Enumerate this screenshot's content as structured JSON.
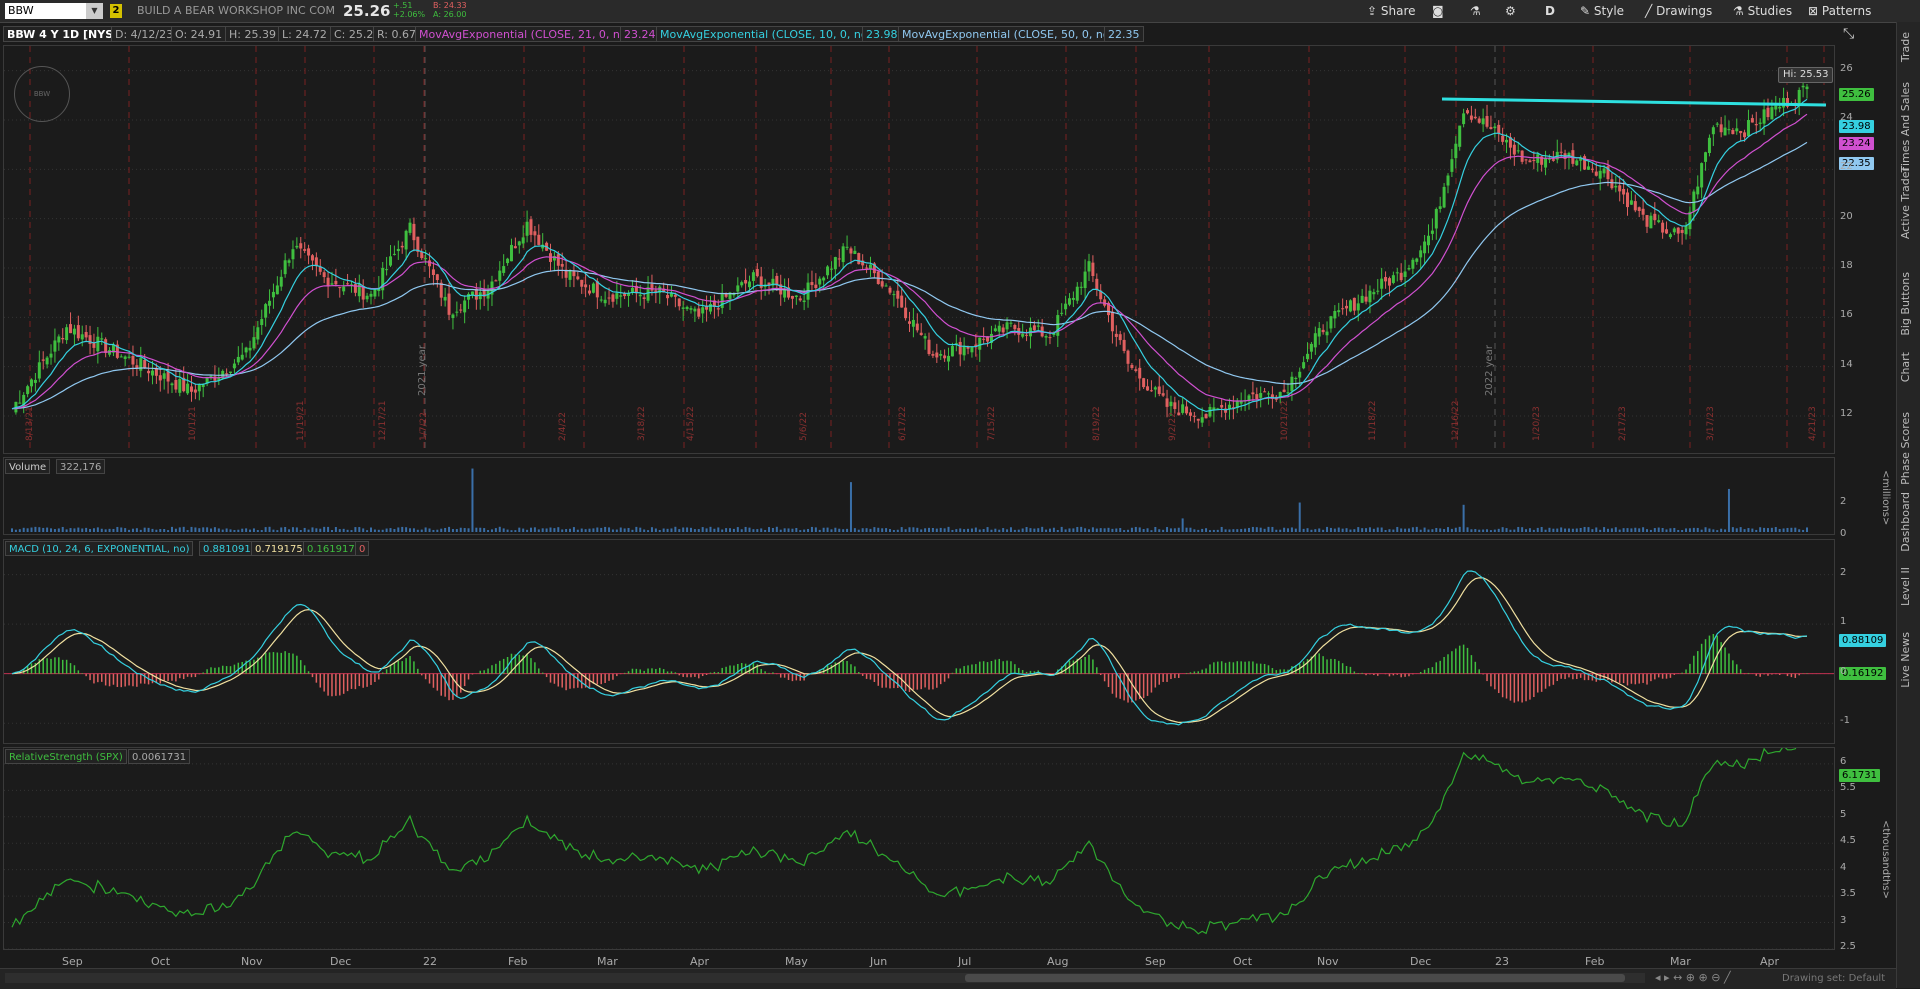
{
  "toolbar": {
    "symbol": "BBW",
    "link_number": "2",
    "company": "BUILD A BEAR WORKSHOP INC COM",
    "last_price": "25.26",
    "net_change": "+.51",
    "pct_change": "+2.06%",
    "bid": "B: 24.33",
    "ask": "A: 26.00",
    "share_label": "Share",
    "aggregation": "D",
    "style_label": "Style",
    "drawings_label": "Drawings",
    "studies_label": "Studies",
    "patterns_label": "Patterns"
  },
  "infobar": {
    "title": "BBW 4 Y 1D [NYSE]",
    "date": "D: 4/12/23",
    "open": "O: 24.91",
    "high": "H: 25.39",
    "low": "L: 24.72",
    "close": "C: 25.26",
    "range": "R: 0.67",
    "ema21_label": "MovAvgExponential (CLOSE, 21, 0, no)",
    "ema21_value": "23.24",
    "ema10_label": "MovAvgExponential (CLOSE, 10, 0, no)",
    "ema10_value": "23.98",
    "ema50_label": "MovAvgExponential (CLOSE, 50, 0, no)",
    "ema50_value": "22.35"
  },
  "price_panel": {
    "hi_label": "Hi: 25.53",
    "last_tag": "25.26",
    "ema10_tag": "23.98",
    "ema21_tag": "23.24",
    "ema50_tag": "22.35",
    "y_ticks": [
      "26",
      "24",
      "22",
      "20",
      "18",
      "16",
      "14",
      "12"
    ],
    "year_markers": [
      "2021 year",
      "2022 year"
    ],
    "date_markers": [
      "8/13/21",
      "10/1/21",
      "11/19/21",
      "12/17/21",
      "1/7/22",
      "2/4/22",
      "3/18/22",
      "4/15/22",
      "5/6/22",
      "6/17/22",
      "7/15/22",
      "8/19/22",
      "9/2/22",
      "10/21/22",
      "11/18/22",
      "12/16/22",
      "1/20/23",
      "2/17/23",
      "3/17/23",
      "4/21/23"
    ]
  },
  "volume_panel": {
    "label": "Volume",
    "value": "322,176",
    "y_ticks": [
      "2",
      "0"
    ],
    "unit": "<millions>"
  },
  "macd_panel": {
    "label": "MACD (10, 24, 6, EXPONENTIAL, no)",
    "value": "0.881091",
    "avg": "0.719175",
    "diff": "0.161917",
    "zero": "0",
    "tag_value": "0.88109",
    "tag_diff": "0.16192",
    "y_ticks": [
      "2",
      "1",
      "0",
      "-1"
    ]
  },
  "rs_panel": {
    "label": "RelativeStrength (SPX)",
    "value": "0.0061731",
    "tag": "6.1731",
    "y_ticks": [
      "6",
      "5.5",
      "5",
      "4.5",
      "4",
      "3.5",
      "3",
      "2.5"
    ],
    "unit": "<thousandths>"
  },
  "x_axis": [
    "Sep",
    "Oct",
    "Nov",
    "Dec",
    "22",
    "Feb",
    "Mar",
    "Apr",
    "May",
    "Jun",
    "Jul",
    "Aug",
    "Sep",
    "Oct",
    "Nov",
    "Dec",
    "23",
    "Feb",
    "Mar",
    "Apr"
  ],
  "right_rail": [
    "Trade",
    "Times And Sales",
    "Active Trader",
    "Big Buttons",
    "Chart",
    "Phase Scores",
    "Dashboard",
    "Level II",
    "Live News"
  ],
  "bottom": {
    "drawing_set": "Drawing set: Default"
  },
  "colors": {
    "up": "#3fbf3f",
    "down": "#e06060",
    "ema10": "#35d0e0",
    "ema21": "#d050d0",
    "ema50": "#90c8f0",
    "trendline": "#2ee0e0",
    "rs": "#2ea82e"
  }
}
